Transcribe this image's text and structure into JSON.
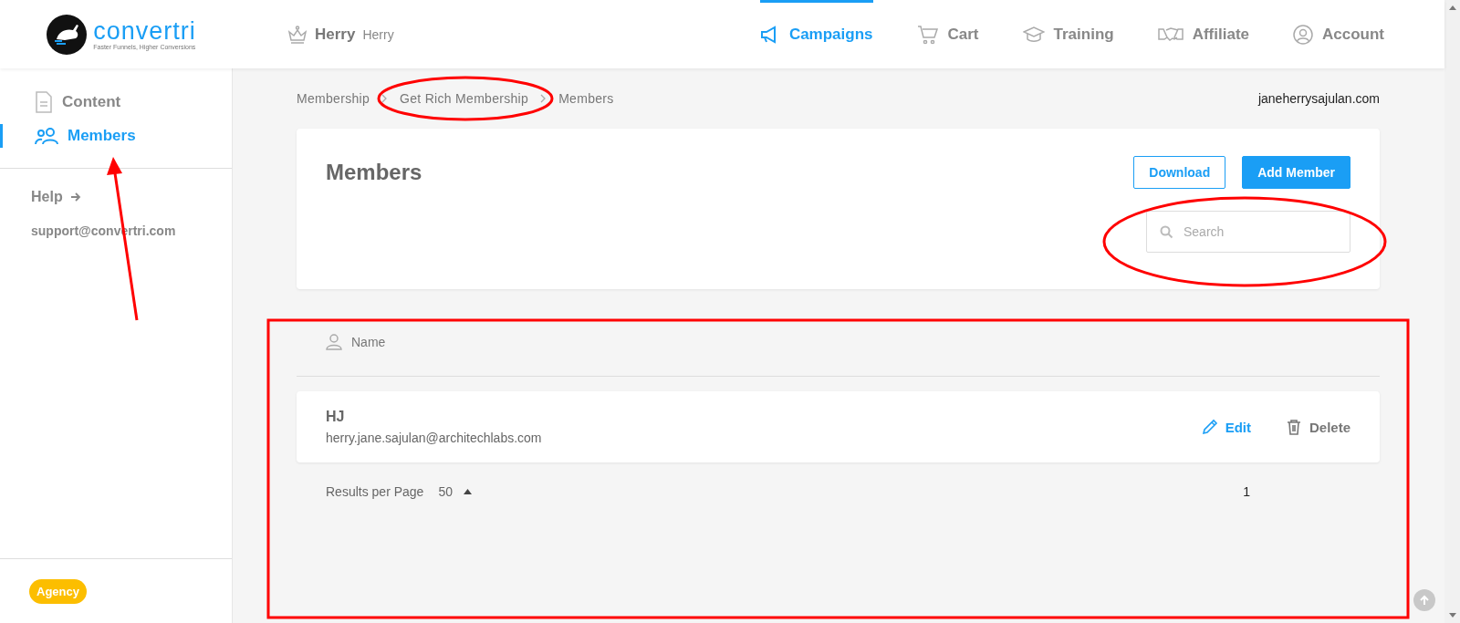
{
  "logo": {
    "name": "convertri",
    "tagline": "Faster Funnels, Higher Conversions"
  },
  "workspace": {
    "name": "Herry",
    "subtitle": "Herry"
  },
  "nav": [
    {
      "label": "Campaigns",
      "selected": true
    },
    {
      "label": "Cart",
      "selected": false
    },
    {
      "label": "Training",
      "selected": false
    },
    {
      "label": "Affiliate",
      "selected": false
    },
    {
      "label": "Account",
      "selected": false
    }
  ],
  "sidebar": {
    "items": [
      {
        "label": "Content",
        "selected": false
      },
      {
        "label": "Members",
        "selected": true
      }
    ],
    "help": "Help",
    "support_email": "support@convertri.com",
    "plan_badge": "Agency"
  },
  "breadcrumb": [
    "Membership",
    "Get Rich Membership",
    "Members"
  ],
  "domain": "janeherrysajulan.com",
  "page": {
    "title": "Members",
    "buttons": [
      {
        "label": "Download",
        "kind": "outline"
      },
      {
        "label": "Add Member",
        "kind": "primary"
      }
    ],
    "search": {
      "placeholder": "Search"
    }
  },
  "table": {
    "columns": [
      "Name"
    ],
    "rows": [
      {
        "name": "HJ",
        "email": "herry.jane.sajulan@architechlabs.com",
        "actions": [
          {
            "label": "Edit",
            "kind": "edit"
          },
          {
            "label": "Delete",
            "kind": "delete"
          }
        ]
      }
    ]
  },
  "pagination": {
    "label": "Results per Page",
    "per_page": "50",
    "pages": [
      "1"
    ]
  }
}
